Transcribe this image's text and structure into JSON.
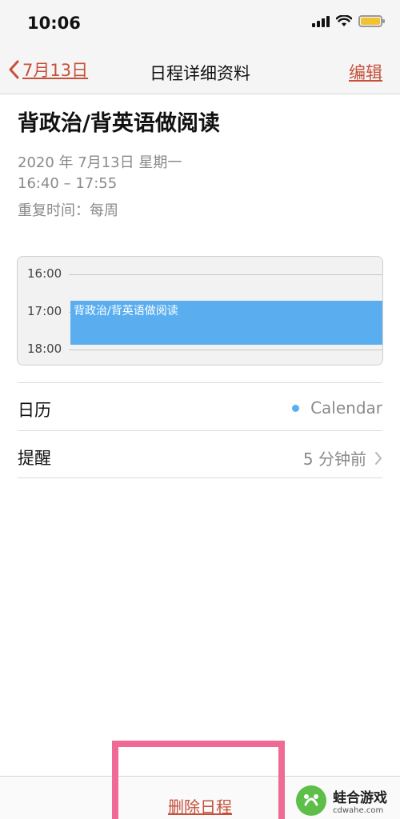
{
  "status_bar": {
    "time": "10:06"
  },
  "nav": {
    "back_label": "7月13日",
    "title": "日程详细资料",
    "edit_label": "编辑"
  },
  "event": {
    "title": "背政治/背英语做阅读",
    "date": "2020 年 7月13日  星期一",
    "time_range": "16:40 – 17:55",
    "repeat": "重复时间：每周"
  },
  "timeline": {
    "hours": [
      "16:00",
      "17:00",
      "18:00"
    ],
    "event_label": "背政治/背英语做阅读"
  },
  "details": {
    "calendar_label": "日历",
    "calendar_value": "Calendar",
    "reminder_label": "提醒",
    "reminder_value": "5 分钟前"
  },
  "actions": {
    "delete_label": "删除日程"
  },
  "watermark": {
    "name": "蛙合游戏",
    "url": "cdwahe.com"
  },
  "colors": {
    "accent": "#c6503a",
    "event_blue": "#5aaef0",
    "highlight": "#ef6a95",
    "battery": "#f2c230"
  }
}
